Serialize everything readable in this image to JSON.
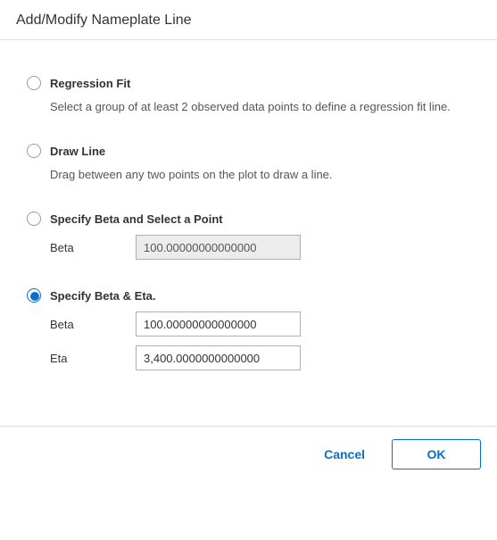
{
  "dialog": {
    "title": "Add/Modify Nameplate Line"
  },
  "options": {
    "regression": {
      "label": "Regression Fit",
      "description": "Select a group of at least 2 observed data points to define a regression fit line.",
      "selected": false
    },
    "draw": {
      "label": "Draw Line",
      "description": "Drag between any two points on the plot to draw a line.",
      "selected": false
    },
    "betaPoint": {
      "label": "Specify Beta and Select a Point",
      "selected": false,
      "betaLabel": "Beta",
      "betaValue": "100.00000000000000"
    },
    "betaEta": {
      "label": "Specify Beta & Eta.",
      "selected": true,
      "betaLabel": "Beta",
      "betaValue": "100.00000000000000",
      "etaLabel": "Eta",
      "etaValue": "3,400.0000000000000"
    }
  },
  "footer": {
    "cancel": "Cancel",
    "ok": "OK"
  }
}
